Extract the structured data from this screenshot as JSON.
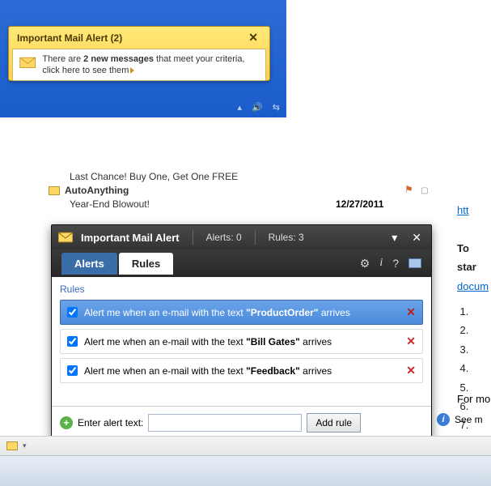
{
  "toast": {
    "title": "Important Mail Alert (2)",
    "msg_prefix": "There are ",
    "msg_bold": "2 new messages",
    "msg_suffix": " that meet your criteria, click here to see them"
  },
  "background": {
    "line1": "Last Chance! Buy One, Get One FREE",
    "sender": "AutoAnything",
    "line3": "Year-End Blowout!",
    "date": "12/27/2011",
    "http": "htt",
    "tostart": "To star",
    "docum": "docum",
    "formore": "For mo",
    "seemore": "See m",
    "list": [
      "",
      "",
      "",
      "",
      "",
      "",
      ""
    ]
  },
  "dialog": {
    "title": "Important Mail Alert",
    "alerts_label": "Alerts:",
    "alerts_count": "0",
    "rules_label": "Rules:",
    "rules_count": "3",
    "tab_alerts": "Alerts",
    "tab_rules": "Rules",
    "section": "Rules",
    "rules": [
      {
        "prefix": "Alert me when an e-mail with the text ",
        "keyword": "\"ProductOrder\"",
        "suffix": " arrives",
        "selected": true,
        "checked": true
      },
      {
        "prefix": "Alert me when an e-mail with the text ",
        "keyword": "\"Bill Gates\"",
        "suffix": " arrives",
        "selected": false,
        "checked": true
      },
      {
        "prefix": "Alert me when an e-mail with the text ",
        "keyword": "\"Feedback\"",
        "suffix": " arrives",
        "selected": false,
        "checked": true
      }
    ],
    "footer_label": "Enter alert text:",
    "add_button": "Add rule"
  }
}
